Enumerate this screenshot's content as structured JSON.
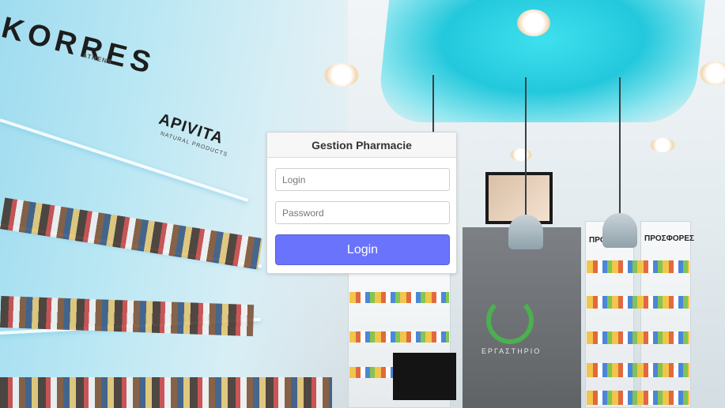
{
  "background": {
    "brand_left": "KORRES",
    "brand_left_small": "ATHENS",
    "brand_middle": "APIVITA",
    "brand_middle_sub": "NATURAL PRODUCTS",
    "shelf_sign_right": "ΠΡΟΣΦΟΡΕΣ",
    "shelf_sign_partial": "ΠΡΟΣ",
    "counter_logo_text": "ΕΡΓΑΣΤΗΡΙΟ"
  },
  "login": {
    "title": "Gestion Pharmacie",
    "login_placeholder": "Login",
    "password_placeholder": "Password",
    "login_value": "",
    "password_value": "",
    "submit_label": "Login"
  },
  "colors": {
    "button": "#6a73fb",
    "accent_glow": "#23c8dc"
  }
}
